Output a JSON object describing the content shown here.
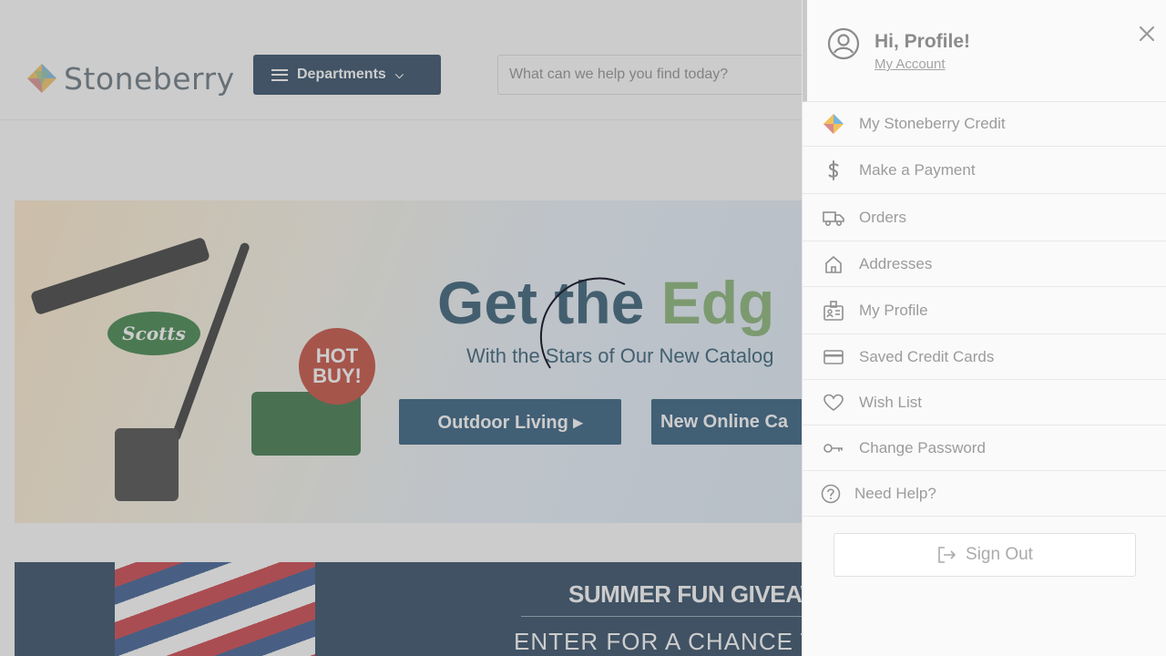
{
  "header": {
    "logo_text": "Stoneberry",
    "departments_label": "Departments",
    "search_placeholder": "What can we help you find today?"
  },
  "hero": {
    "title_part1": "Get the ",
    "title_part2": "Edg",
    "subtitle": "With the Stars of Our New Catalog",
    "button1": "Outdoor Living ▸",
    "button2": "New Online Ca",
    "badge_scotts": "Scotts",
    "badge_hotbuy": "HOT BUY!"
  },
  "promo": {
    "title": "SUMMER FUN GIVEAW",
    "subtitle": "ENTER FOR A CHANCE T"
  },
  "drawer": {
    "greeting": "Hi, Profile!",
    "account_link": "My Account",
    "menu": [
      {
        "label": "My Stoneberry Credit",
        "icon": "stoneberry-logo-icon"
      },
      {
        "label": "Make a Payment",
        "icon": "dollar-icon"
      },
      {
        "label": "Orders",
        "icon": "truck-icon"
      },
      {
        "label": "Addresses",
        "icon": "home-icon"
      },
      {
        "label": "My Profile",
        "icon": "id-badge-icon"
      },
      {
        "label": "Saved Credit Cards",
        "icon": "credit-card-icon"
      },
      {
        "label": "Wish List",
        "icon": "heart-icon"
      },
      {
        "label": "Change Password",
        "icon": "key-icon"
      },
      {
        "label": "Need Help?",
        "icon": "question-circle-icon"
      }
    ],
    "sign_out": "Sign Out"
  },
  "colors": {
    "brand_navy": "#1f3d5a",
    "drawer_text": "#9b9b9b",
    "overlay": "rgba(120,120,120,0.38)"
  }
}
